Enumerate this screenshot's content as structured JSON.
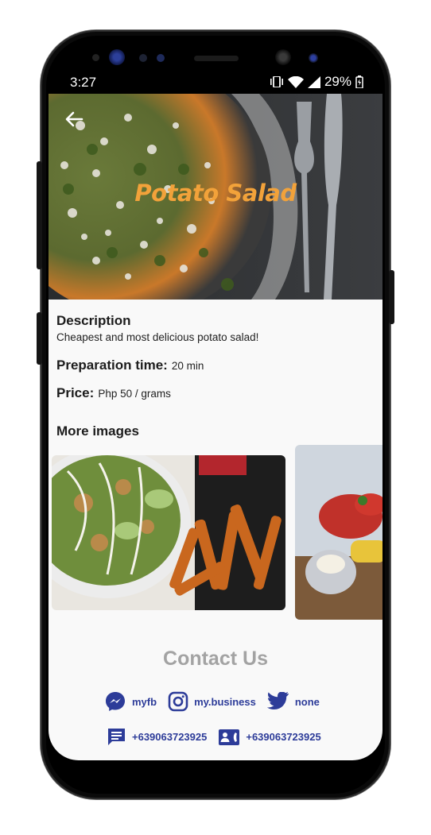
{
  "status_bar": {
    "time": "3:27",
    "battery_percent": "29%",
    "icons": [
      "vibrate-icon",
      "wifi-icon",
      "signal-icon",
      "battery-icon"
    ]
  },
  "recipe": {
    "title": "Potato Salad",
    "description_label": "Description",
    "description_text": "Cheapest and most delicious potato salad!",
    "prep_label": "Preparation time:",
    "prep_value": "20 min",
    "price_label": "Price:",
    "price_value": "Php 50 / grams",
    "more_images_label": "More images"
  },
  "contact": {
    "title": "Contact Us",
    "messenger": "myfb",
    "instagram": "my.business",
    "twitter": "none",
    "sms": "+639063723925",
    "phone": "+639063723925"
  },
  "colors": {
    "title_orange": "#f2a23a",
    "contact_blue": "#2d3c99",
    "contact_title_gray": "#a3a3a3"
  }
}
